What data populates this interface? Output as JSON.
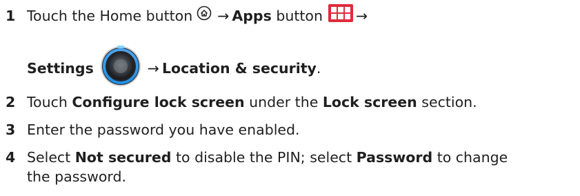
{
  "steps": [
    {
      "num": "1",
      "parts": {
        "t1": "Touch the Home button",
        "arrow": "→",
        "apps": "Apps",
        "button": "button",
        "settings": "Settings",
        "loc": "Location & security",
        "dot": "."
      },
      "icons": [
        "home-icon",
        "apps-icon",
        "settings-icon"
      ]
    },
    {
      "num": "2",
      "parts": {
        "t1": "Touch ",
        "b1": "Configure lock screen",
        "t2": " under the ",
        "b2": "Lock screen",
        "t3": " section."
      }
    },
    {
      "num": "3",
      "parts": {
        "t1": "Enter the password you have enabled."
      }
    },
    {
      "num": "4",
      "parts": {
        "t1": "Select ",
        "b1": "Not secured",
        "t2": " to disable the PIN; select ",
        "b2": "Password",
        "t3": " to change",
        "t4": "the password."
      }
    }
  ],
  "colors": {
    "text": "#1f1f1f",
    "apps_icon_bg": "#e02a3b",
    "settings_ring": "#1e90e8"
  }
}
